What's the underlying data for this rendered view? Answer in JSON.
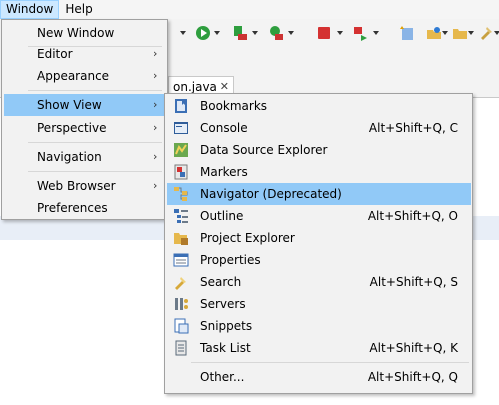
{
  "menubar": {
    "items": [
      {
        "label": "Window"
      },
      {
        "label": "Help"
      }
    ]
  },
  "toolbar": {
    "icons": [
      "dropdown-arrow-icon",
      "run-icon",
      "run-config-icon",
      "external-tools-icon",
      "stop-icon",
      "skip-icon",
      "new-java-icon",
      "open-type-icon",
      "folder-icon",
      "pin-icon"
    ]
  },
  "editor": {
    "tab_label": "on.java",
    "tab_close": "✕"
  },
  "window_menu": {
    "items": [
      {
        "label": "New Window",
        "submenu": false
      },
      {
        "label": "Editor",
        "submenu": true
      },
      {
        "label": "Appearance",
        "submenu": true
      },
      {
        "label": "Show View",
        "submenu": true,
        "highlighted": true
      },
      {
        "label": "Perspective",
        "submenu": true
      },
      {
        "label": "Navigation",
        "submenu": true
      },
      {
        "label": "Web Browser",
        "submenu": true
      },
      {
        "label": "Preferences",
        "submenu": false
      }
    ],
    "arrow_glyph": "›"
  },
  "show_view_menu": {
    "items": [
      {
        "label": "Bookmarks",
        "shortcut": "",
        "icon": "bookmarks-icon"
      },
      {
        "label": "Console",
        "shortcut": "Alt+Shift+Q, C",
        "icon": "console-icon"
      },
      {
        "label": "Data Source Explorer",
        "shortcut": "",
        "icon": "data-source-explorer-icon"
      },
      {
        "label": "Markers",
        "shortcut": "",
        "icon": "markers-icon"
      },
      {
        "label": "Navigator (Deprecated)",
        "shortcut": "",
        "icon": "navigator-icon",
        "highlighted": true
      },
      {
        "label": "Outline",
        "shortcut": "Alt+Shift+Q, O",
        "icon": "outline-icon"
      },
      {
        "label": "Project Explorer",
        "shortcut": "",
        "icon": "project-explorer-icon"
      },
      {
        "label": "Properties",
        "shortcut": "",
        "icon": "properties-icon"
      },
      {
        "label": "Search",
        "shortcut": "Alt+Shift+Q, S",
        "icon": "search-icon"
      },
      {
        "label": "Servers",
        "shortcut": "",
        "icon": "servers-icon"
      },
      {
        "label": "Snippets",
        "shortcut": "",
        "icon": "snippets-icon"
      },
      {
        "label": "Task List",
        "shortcut": "Alt+Shift+Q, K",
        "icon": "task-list-icon"
      },
      {
        "label": "Other...",
        "shortcut": "Alt+Shift+Q, Q",
        "icon": ""
      }
    ]
  }
}
